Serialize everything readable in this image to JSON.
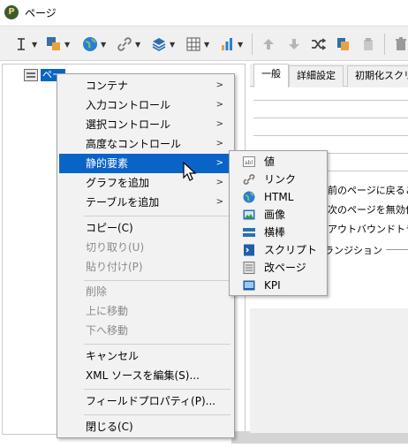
{
  "window": {
    "title": "ページ",
    "app_icon_letter": "P"
  },
  "toolbar": {
    "icons": [
      "text-cursor-icon",
      "form-component-icon",
      "globe-icon",
      "link-icon",
      "layers-icon",
      "table-icon",
      "bar-chart-icon",
      "arrow-up-icon",
      "arrow-down-icon",
      "shuffle-icon",
      "paste-icon",
      "clipboard-icon",
      "delete-icon"
    ]
  },
  "tree": {
    "node_label": "ページ"
  },
  "right_panel": {
    "tabs": [
      "一般",
      "詳細設定",
      "初期化スクリ"
    ],
    "options": [
      "前のページに戻るこ",
      "次のページを無効化",
      "アウトバウンドトラン"
    ],
    "group_label": "ランジション"
  },
  "context_menu": {
    "items": [
      {
        "label": "コンテナ",
        "submenu": true,
        "disabled": false
      },
      {
        "label": "入力コントロール",
        "submenu": true,
        "disabled": false
      },
      {
        "label": "選択コントロール",
        "submenu": true,
        "disabled": false
      },
      {
        "label": "高度なコントロール",
        "submenu": true,
        "disabled": false
      },
      {
        "label": "静的要素",
        "submenu": true,
        "disabled": false,
        "highlighted": true
      },
      {
        "label": "グラフを追加",
        "submenu": true,
        "disabled": false
      },
      {
        "label": "テーブルを追加",
        "submenu": true,
        "disabled": false
      },
      {
        "label": "コピー(C)",
        "disabled": false
      },
      {
        "label": "切り取り(U)",
        "disabled": true
      },
      {
        "label": "貼り付け(P)",
        "disabled": true
      },
      {
        "label": "削除",
        "disabled": true
      },
      {
        "label": "上に移動",
        "disabled": true
      },
      {
        "label": "下へ移動",
        "disabled": true
      },
      {
        "label": "キャンセル",
        "disabled": false
      },
      {
        "label": "XML ソースを編集(S)...",
        "disabled": false
      },
      {
        "label": "フィールドプロパティ(P)...",
        "disabled": false
      },
      {
        "label": "閉じる(C)",
        "disabled": false
      }
    ]
  },
  "submenu": {
    "items": [
      {
        "label": "値",
        "icon": "value-field-icon"
      },
      {
        "label": "リンク",
        "icon": "link-icon"
      },
      {
        "label": "HTML",
        "icon": "globe-icon"
      },
      {
        "label": "画像",
        "icon": "image-icon"
      },
      {
        "label": "横棒",
        "icon": "horizontal-bar-icon"
      },
      {
        "label": "スクリプト",
        "icon": "script-icon"
      },
      {
        "label": "改ページ",
        "icon": "page-break-icon"
      },
      {
        "label": "KPI",
        "icon": "kpi-icon"
      }
    ]
  },
  "colors": {
    "highlight": "#0a64c8",
    "menu_bg": "#f2f2f2",
    "toolbar_bg": "#f0f0f0"
  }
}
